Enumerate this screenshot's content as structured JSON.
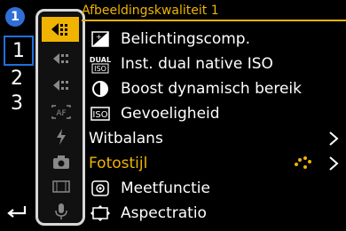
{
  "sidebar": {
    "badge": "1",
    "pages": [
      "1",
      "2",
      "3"
    ]
  },
  "header": {
    "title": "Afbeeldingskwaliteit 1"
  },
  "menu": {
    "items": [
      {
        "label": "Belichtingscomp."
      },
      {
        "label": "Inst. dual native ISO",
        "icon_text": "DUAL ISO"
      },
      {
        "label": "Boost dynamisch bereik"
      },
      {
        "label": "Gevoeligheid",
        "icon_text": "ISO"
      },
      {
        "label": "Witbalans"
      },
      {
        "label": "Fotostijl"
      },
      {
        "label": "Meetfunctie"
      },
      {
        "label": "Aspectratio"
      }
    ]
  },
  "colors": {
    "accent": "#f0b400",
    "selection": "#1f6fe0",
    "badge": "#2f6fd6"
  }
}
